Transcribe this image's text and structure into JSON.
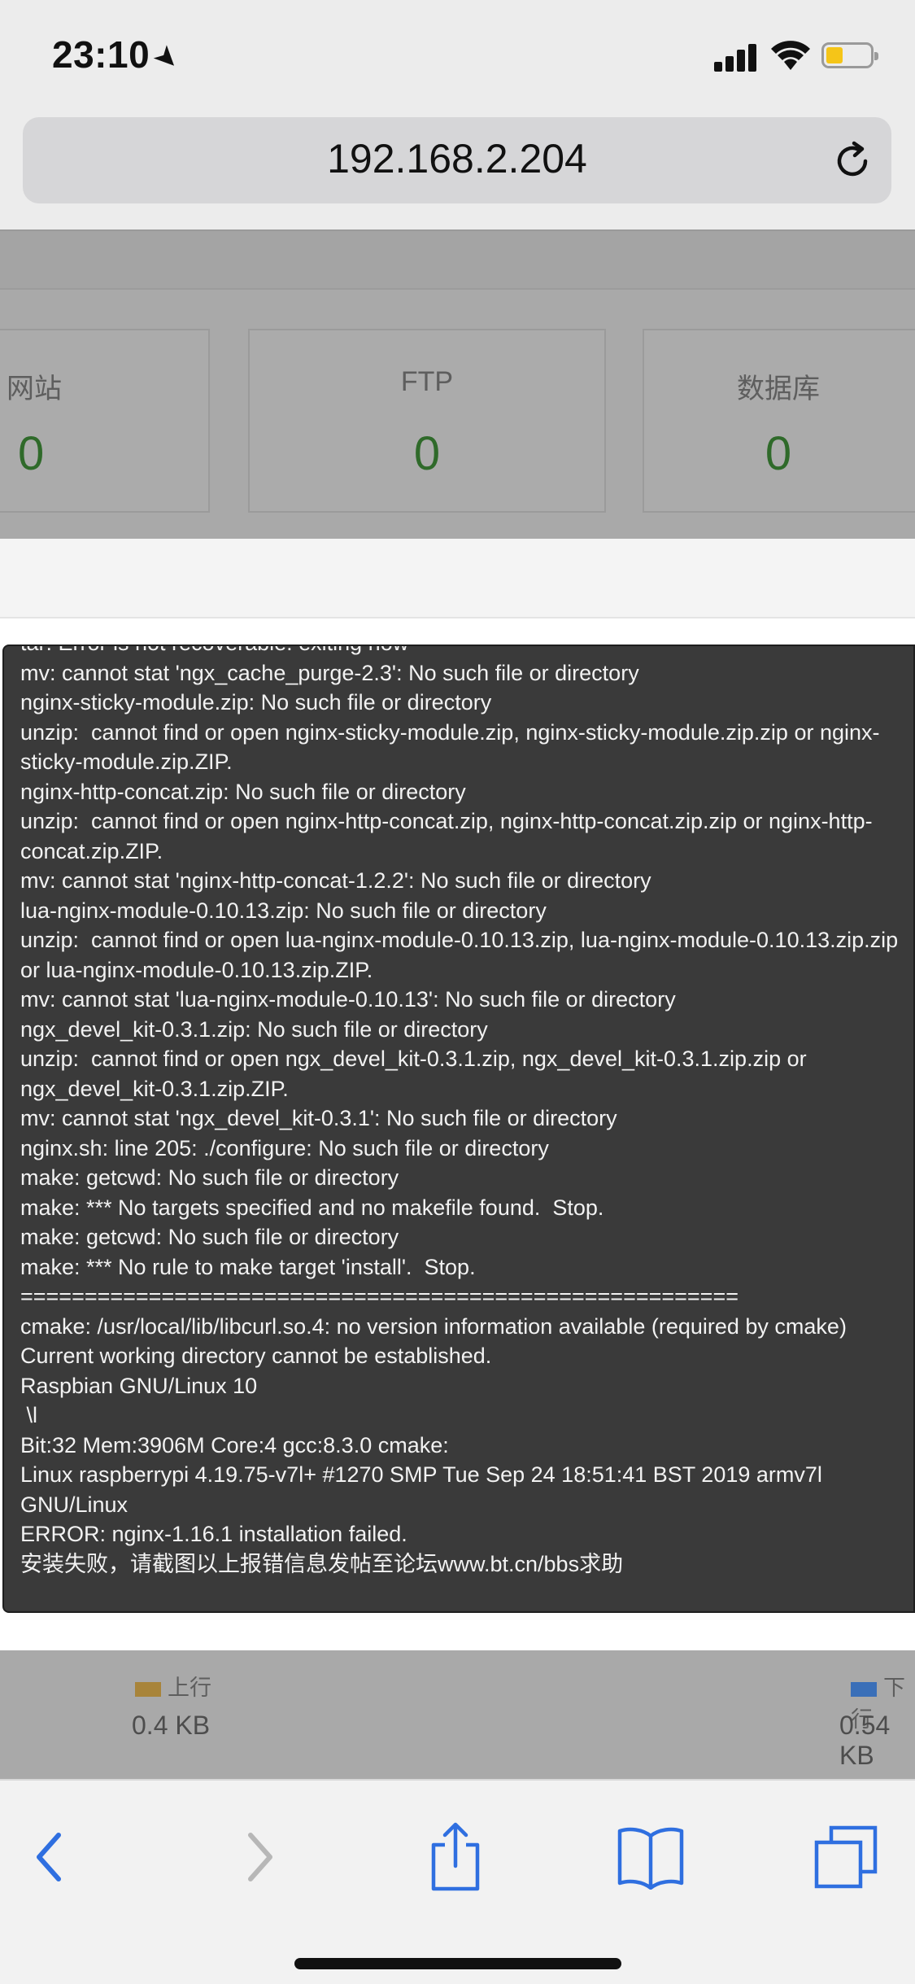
{
  "status_bar": {
    "time": "23:10",
    "location_icon": "location-arrow-icon",
    "signal_icon": "cellular-signal-icon",
    "wifi_icon": "wifi-icon",
    "battery_icon": "battery-icon"
  },
  "browser": {
    "url": "192.168.2.204",
    "reload_icon": "reload-icon"
  },
  "stats": [
    {
      "label": "网站",
      "value": "0"
    },
    {
      "label": "FTP",
      "value": "0"
    },
    {
      "label": "数据库",
      "value": "0"
    }
  ],
  "terminal": {
    "lines": [
      "tar: Error is not recoverable: exiting now",
      "mv: cannot stat 'ngx_cache_purge-2.3': No such file or directory",
      "nginx-sticky-module.zip: No such file or directory",
      "unzip:  cannot find or open nginx-sticky-module.zip, nginx-sticky-module.zip.zip or nginx-sticky-module.zip.ZIP.",
      "nginx-http-concat.zip: No such file or directory",
      "unzip:  cannot find or open nginx-http-concat.zip, nginx-http-concat.zip.zip or nginx-http-concat.zip.ZIP.",
      "mv: cannot stat 'nginx-http-concat-1.2.2': No such file or directory",
      "lua-nginx-module-0.10.13.zip: No such file or directory",
      "unzip:  cannot find or open lua-nginx-module-0.10.13.zip, lua-nginx-module-0.10.13.zip.zip or lua-nginx-module-0.10.13.zip.ZIP.",
      "mv: cannot stat 'lua-nginx-module-0.10.13': No such file or directory",
      "ngx_devel_kit-0.3.1.zip: No such file or directory",
      "unzip:  cannot find or open ngx_devel_kit-0.3.1.zip, ngx_devel_kit-0.3.1.zip.zip or ngx_devel_kit-0.3.1.zip.ZIP.",
      "mv: cannot stat 'ngx_devel_kit-0.3.1': No such file or directory",
      "nginx.sh: line 205: ./configure: No such file or directory",
      "make: getcwd: No such file or directory",
      "make: *** No targets specified and no makefile found.  Stop.",
      "make: getcwd: No such file or directory",
      "make: *** No rule to make target 'install'.  Stop.",
      "========================================================",
      "cmake: /usr/local/lib/libcurl.so.4: no version information available (required by cmake)",
      "Current working directory cannot be established.",
      "Raspbian GNU/Linux 10",
      " \\l",
      "Bit:32 Mem:3906M Core:4 gcc:8.3.0 cmake:",
      "Linux raspberrypi 4.19.75-v7l+ #1270 SMP Tue Sep 24 18:51:41 BST 2019 armv7l GNU/Linux",
      "ERROR: nginx-1.16.1 installation failed.",
      "安装失败，请截图以上报错信息发帖至论坛www.bt.cn/bbs求助"
    ]
  },
  "traffic": {
    "up": {
      "label": "上行",
      "value": "0.4 KB",
      "color": "#a8843a"
    },
    "down": {
      "label": "下行",
      "value": "0.54 KB",
      "color": "#3a6fb8"
    }
  },
  "toolbar": {
    "accent": "#2f6fe0",
    "items": [
      "back-icon",
      "forward-icon",
      "share-icon",
      "bookmarks-icon",
      "tabs-icon"
    ]
  }
}
